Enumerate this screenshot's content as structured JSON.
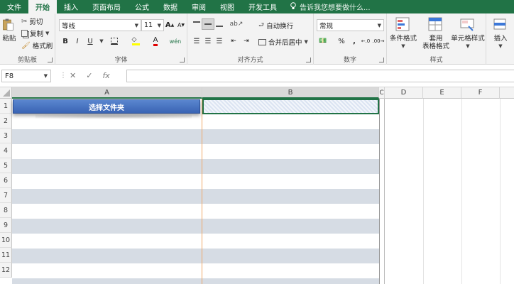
{
  "ribbon_tabs": [
    "文件",
    "开始",
    "插入",
    "页面布局",
    "公式",
    "数据",
    "审阅",
    "视图",
    "开发工具"
  ],
  "tell_me": "告诉我您想要做什么...",
  "clipboard": {
    "paste": "粘贴",
    "cut": "剪切",
    "copy": "复制",
    "format_painter": "格式刷",
    "label": "剪贴板"
  },
  "font": {
    "name": "等线",
    "size": "11",
    "bold": "B",
    "italic": "I",
    "underline": "U",
    "grow": "A",
    "shrink": "A",
    "label": "字体"
  },
  "alignment": {
    "wrap": "自动换行",
    "merge": "合并后居中",
    "label": "对齐方式"
  },
  "number": {
    "format": "常规",
    "percent": "%",
    "comma": ",",
    "label": "数字"
  },
  "styles": {
    "conditional": "条件格式",
    "table1": "套用",
    "table2": "表格格式",
    "cell_styles": "单元格样式",
    "label": "样式"
  },
  "cells": {
    "insert": "插入"
  },
  "formula_bar": {
    "name_box": "F8",
    "cancel": "✕",
    "enter": "✓",
    "fx": "fx",
    "value": ""
  },
  "columns": [
    "A",
    "B",
    "C",
    "D",
    "E",
    "F"
  ],
  "rows": [
    "1",
    "2",
    "3",
    "4",
    "5",
    "6",
    "7",
    "8",
    "9",
    "10",
    "11",
    "12"
  ],
  "cell_button": "选择文件夹",
  "colors": {
    "accent": "#217346",
    "band": "#d6dce4",
    "button": "#4a76c2"
  }
}
